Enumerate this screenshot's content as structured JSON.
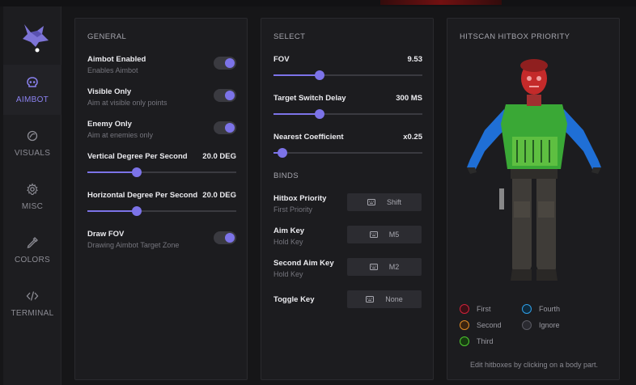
{
  "sidebar": {
    "items": [
      {
        "label": "AIMBOT",
        "icon": "skull-icon",
        "active": true
      },
      {
        "label": "VISUALS",
        "icon": "visuals-icon",
        "active": false
      },
      {
        "label": "MISC",
        "icon": "gear-icon",
        "active": false
      },
      {
        "label": "COLORS",
        "icon": "eyedropper-icon",
        "active": false
      },
      {
        "label": "TERMINAL",
        "icon": "code-icon",
        "active": false
      }
    ]
  },
  "general": {
    "title": "GENERAL",
    "aimbot_enabled": {
      "title": "Aimbot Enabled",
      "sub": "Enables Aimbot",
      "on": true
    },
    "visible_only": {
      "title": "Visible Only",
      "sub": "Aim at visible only points",
      "on": true
    },
    "enemy_only": {
      "title": "Enemy Only",
      "sub": "Aim at enemies only",
      "on": true
    },
    "vertical": {
      "title": "Vertical Degree Per Second",
      "value": "20.0 DEG",
      "fraction": 0.33
    },
    "horizontal": {
      "title": "Horizontal Degree Per Second",
      "value": "20.0 DEG",
      "fraction": 0.33
    },
    "draw_fov": {
      "title": "Draw FOV",
      "sub": "Drawing Aimbot Target Zone",
      "on": true
    }
  },
  "select": {
    "title": "SELECT",
    "fov": {
      "title": "FOV",
      "value": "9.53",
      "fraction": 0.31
    },
    "switch_delay": {
      "title": "Target Switch Delay",
      "value": "300 MS",
      "fraction": 0.31
    },
    "nearest": {
      "title": "Nearest Coefficient",
      "value": "x0.25",
      "fraction": 0.06
    },
    "binds_title": "BINDS",
    "binds": [
      {
        "title": "Hitbox Priority",
        "sub": "First Priority",
        "key": "Shift"
      },
      {
        "title": "Aim Key",
        "sub": "Hold Key",
        "key": "M5"
      },
      {
        "title": "Second Aim Key",
        "sub": "Hold Key",
        "key": "M2"
      },
      {
        "title": "Toggle Key",
        "sub": "",
        "key": "None"
      }
    ]
  },
  "hitbox": {
    "title": "HITSCAN HITBOX PRIORITY",
    "legend": [
      {
        "label": "First",
        "color": "#d0213a"
      },
      {
        "label": "Fourth",
        "color": "#2f9fe6"
      },
      {
        "label": "Second",
        "color": "#e08a22"
      },
      {
        "label": "Ignore",
        "color": "#3c3c44"
      },
      {
        "label": "Third",
        "color": "#4ec92e"
      }
    ],
    "footnote": "Edit hitboxes by clicking on a body part."
  },
  "colors": {
    "accent": "#7c73e8",
    "head": "#c42a2a",
    "torso": "#3aa836",
    "arms": "#1f6fd6"
  }
}
